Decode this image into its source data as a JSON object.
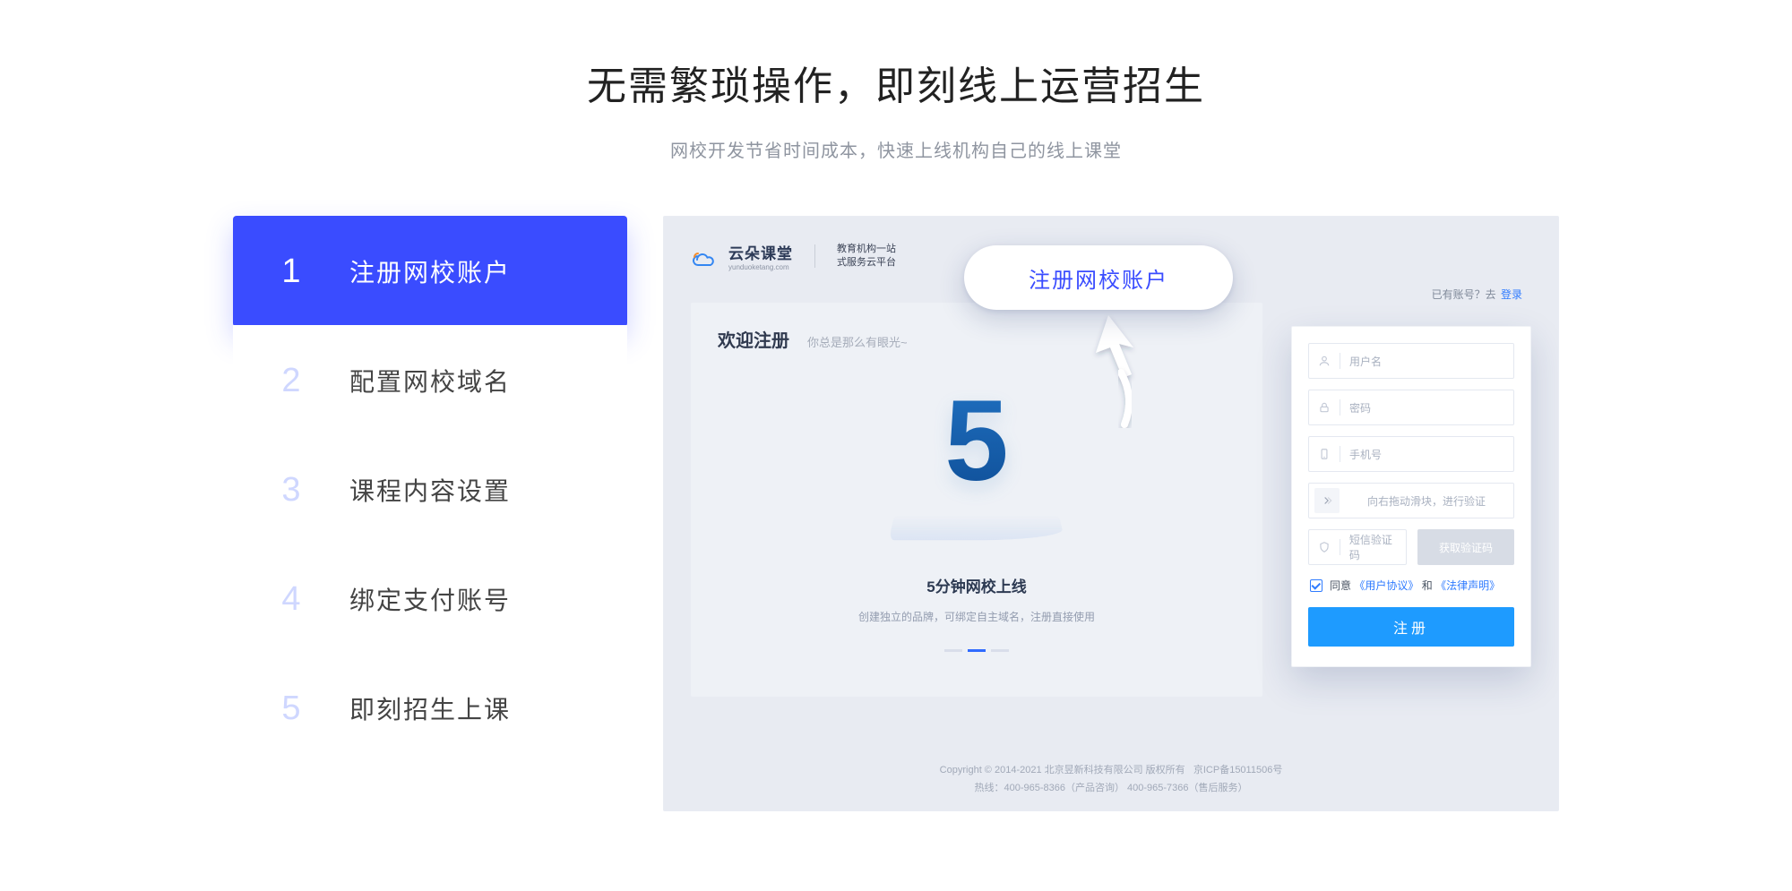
{
  "headline": "无需繁琐操作，即刻线上运营招生",
  "subhead": "网校开发节省时间成本，快速上线机构自己的线上课堂",
  "steps": [
    {
      "num": "1",
      "label": "注册网校账户",
      "active": true
    },
    {
      "num": "2",
      "label": "配置网校域名",
      "active": false
    },
    {
      "num": "3",
      "label": "课程内容设置",
      "active": false
    },
    {
      "num": "4",
      "label": "绑定支付账号",
      "active": false
    },
    {
      "num": "5",
      "label": "即刻招生上课",
      "active": false
    }
  ],
  "overlay": {
    "bubble": "注册网校账户"
  },
  "mock": {
    "brand": "云朵课堂",
    "brand_domain": "yunduoketang.com",
    "tagline_l1": "教育机构一站",
    "tagline_l2": "式服务云平台",
    "welcome": "欢迎注册",
    "slogan": "你总是那么有眼光~",
    "illus_title": "5分钟网校上线",
    "illus_sub": "创建独立的品牌，可绑定自主域名，注册直接使用",
    "login_hint_prefix": "已有账号？去",
    "login_hint_link": "登录",
    "fields": {
      "username": "用户名",
      "password": "密码",
      "phone": "手机号",
      "slider": "向右拖动滑块，进行验证",
      "smscode": "短信验证码",
      "getcode": "获取验证码"
    },
    "agree": {
      "prefix": "同意",
      "ua_open": "《",
      "ua": "用户协议",
      "ua_close": "》",
      "and": "和",
      "law_open": "《",
      "law": "法律声明",
      "law_close": "》"
    },
    "register_btn": "注册",
    "footer_l1_a": "Copyright © 2014-2021 北京昱新科技有限公司 版权所有",
    "footer_l1_b": "京ICP备15011506号",
    "footer_l2": "热线：400-965-8366（产品咨询） 400-965-7366（售后服务）"
  }
}
